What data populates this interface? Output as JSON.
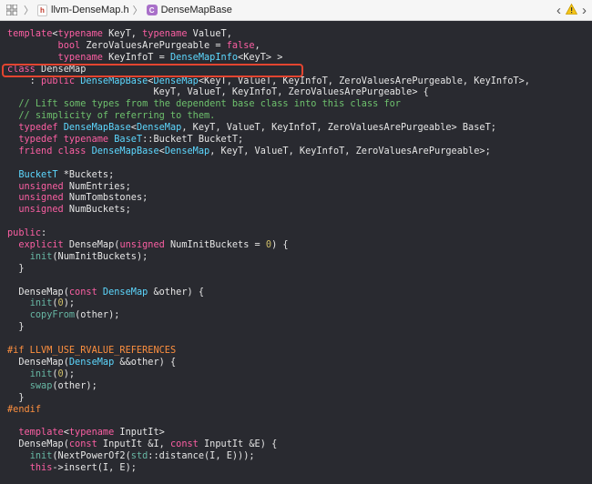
{
  "jumpbar": {
    "file_name": "llvm-DenseMap.h",
    "file_icon_letter": "h",
    "class_icon_letter": "C",
    "symbol_name": "DenseMapBase",
    "back_glyph": "‹",
    "forward_glyph": "›",
    "warning_glyph": "⚠"
  },
  "code_lines": [
    [
      [
        "kw",
        "template"
      ],
      [
        "",
        "<"
      ],
      [
        "kw",
        "typename"
      ],
      [
        "",
        " KeyT, "
      ],
      [
        "kw",
        "typename"
      ],
      [
        "",
        " ValueT,"
      ]
    ],
    [
      [
        "",
        " "
      ],
      [
        "kw",
        "bool"
      ],
      [
        "",
        " ZeroValuesArePurgeable = "
      ],
      [
        "kw",
        "false"
      ],
      [
        "",
        ","
      ]
    ],
    [
      [
        "",
        " "
      ],
      [
        "kw",
        "typename"
      ],
      [
        "",
        " KeyInfoT = "
      ],
      [
        "ty",
        "DenseMapInfo"
      ],
      [
        "",
        "<KeyT> >"
      ]
    ],
    [
      [
        "kw",
        "class"
      ],
      [
        "",
        " DenseMap"
      ]
    ],
    [
      [
        "",
        "    : "
      ],
      [
        "kw",
        "public"
      ],
      [
        "",
        " "
      ],
      [
        "ty",
        "DenseMapBase"
      ],
      [
        "",
        "<"
      ],
      [
        "ty",
        "DenseMap"
      ],
      [
        "",
        "<KeyT, ValueT, KeyInfoT, ZeroValuesArePurgeable, KeyInfoT>,"
      ]
    ],
    [
      [
        "",
        "                          KeyT, ValueT, KeyInfoT, ZeroValuesArePurgeable> {"
      ]
    ],
    [
      [
        "cm",
        "  // Lift some types from the dependent base class into this class for"
      ]
    ],
    [
      [
        "cm",
        "  // simplicity of referring to them."
      ]
    ],
    [
      [
        "",
        "  "
      ],
      [
        "kw",
        "typedef"
      ],
      [
        "",
        " "
      ],
      [
        "ty",
        "DenseMapBase"
      ],
      [
        "",
        "<"
      ],
      [
        "ty",
        "DenseMap"
      ],
      [
        "",
        ", KeyT, ValueT, KeyInfoT, ZeroValuesArePurgeable> BaseT;"
      ]
    ],
    [
      [
        "",
        "  "
      ],
      [
        "kw",
        "typedef"
      ],
      [
        "",
        " "
      ],
      [
        "kw",
        "typename"
      ],
      [
        "",
        " "
      ],
      [
        "ty",
        "BaseT"
      ],
      [
        "",
        "::BucketT BucketT;"
      ]
    ],
    [
      [
        "",
        "  "
      ],
      [
        "kw",
        "friend"
      ],
      [
        "",
        " "
      ],
      [
        "kw",
        "class"
      ],
      [
        "",
        " "
      ],
      [
        "ty",
        "DenseMapBase"
      ],
      [
        "",
        "<"
      ],
      [
        "ty",
        "DenseMap"
      ],
      [
        "",
        ", KeyT, ValueT, KeyInfoT, ZeroValuesArePurgeable>;"
      ]
    ],
    [
      [
        "",
        ""
      ]
    ],
    [
      [
        "",
        "  "
      ],
      [
        "ty",
        "BucketT"
      ],
      [
        "",
        " *Buckets;"
      ]
    ],
    [
      [
        "",
        "  "
      ],
      [
        "kw",
        "unsigned"
      ],
      [
        "",
        " NumEntries;"
      ]
    ],
    [
      [
        "",
        "  "
      ],
      [
        "kw",
        "unsigned"
      ],
      [
        "",
        " NumTombstones;"
      ]
    ],
    [
      [
        "",
        "  "
      ],
      [
        "kw",
        "unsigned"
      ],
      [
        "",
        " NumBuckets;"
      ]
    ],
    [
      [
        "",
        ""
      ]
    ],
    [
      [
        "kw",
        "public"
      ],
      [
        "",
        ":"
      ]
    ],
    [
      [
        "",
        "  "
      ],
      [
        "kw",
        "explicit"
      ],
      [
        "",
        " DenseMap("
      ],
      [
        "kw",
        "unsigned"
      ],
      [
        "",
        " NumInitBuckets = "
      ],
      [
        "num",
        "0"
      ],
      [
        "",
        ") {"
      ]
    ],
    [
      [
        "",
        "    "
      ],
      [
        "fn",
        "init"
      ],
      [
        "",
        "(NumInitBuckets);"
      ]
    ],
    [
      [
        "",
        "  }"
      ]
    ],
    [
      [
        "",
        ""
      ]
    ],
    [
      [
        "",
        "  DenseMap("
      ],
      [
        "kw",
        "const"
      ],
      [
        "",
        " "
      ],
      [
        "ty",
        "DenseMap"
      ],
      [
        "",
        " &other) {"
      ]
    ],
    [
      [
        "",
        "    "
      ],
      [
        "fn",
        "init"
      ],
      [
        "",
        "("
      ],
      [
        "num",
        "0"
      ],
      [
        "",
        ");"
      ]
    ],
    [
      [
        "",
        "    "
      ],
      [
        "fn",
        "copyFrom"
      ],
      [
        "",
        "(other);"
      ]
    ],
    [
      [
        "",
        "  }"
      ]
    ],
    [
      [
        "",
        ""
      ]
    ],
    [
      [
        "pp",
        "#if LLVM_USE_RVALUE_REFERENCES"
      ]
    ],
    [
      [
        "",
        "  DenseMap("
      ],
      [
        "ty",
        "DenseMap"
      ],
      [
        "",
        " &&other) {"
      ]
    ],
    [
      [
        "",
        "    "
      ],
      [
        "fn",
        "init"
      ],
      [
        "",
        "("
      ],
      [
        "num",
        "0"
      ],
      [
        "",
        ");"
      ]
    ],
    [
      [
        "",
        "    "
      ],
      [
        "fn",
        "swap"
      ],
      [
        "",
        "(other);"
      ]
    ],
    [
      [
        "",
        "  }"
      ]
    ],
    [
      [
        "pp",
        "#endif"
      ]
    ],
    [
      [
        "",
        ""
      ]
    ],
    [
      [
        "",
        "  "
      ],
      [
        "kw",
        "template"
      ],
      [
        "",
        "<"
      ],
      [
        "kw",
        "typename"
      ],
      [
        "",
        " InputIt>"
      ]
    ],
    [
      [
        "",
        "  DenseMap("
      ],
      [
        "kw",
        "const"
      ],
      [
        "",
        " InputIt &I, "
      ],
      [
        "kw",
        "const"
      ],
      [
        "",
        " InputIt &E) {"
      ]
    ],
    [
      [
        "",
        "    "
      ],
      [
        "fn",
        "init"
      ],
      [
        "",
        "(NextPowerOf2("
      ],
      [
        "fn",
        "std"
      ],
      [
        "",
        "::distance(I, E)));"
      ]
    ],
    [
      [
        "",
        "    "
      ],
      [
        "kw",
        "this"
      ],
      [
        "",
        "->insert(I, E);"
      ]
    ]
  ]
}
